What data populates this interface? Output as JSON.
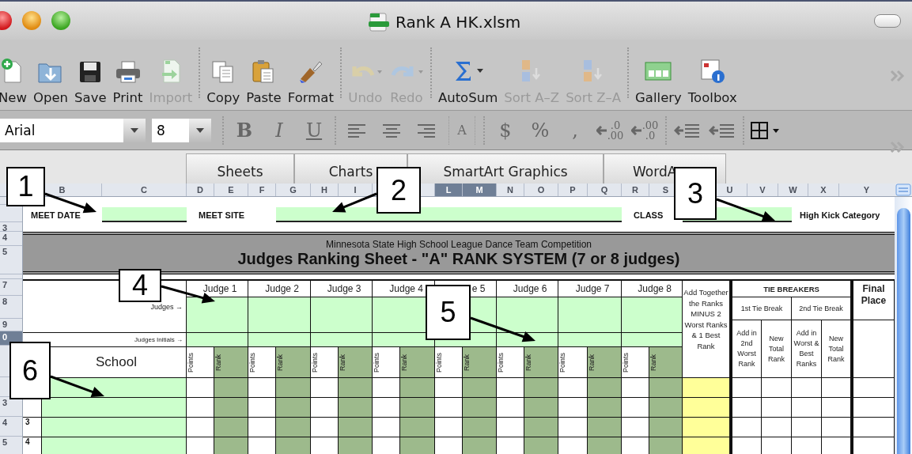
{
  "window": {
    "title": "Rank A HK.xlsm"
  },
  "toolbar": [
    {
      "kind": "new",
      "label": "New",
      "disabled": false
    },
    {
      "kind": "open",
      "label": "Open",
      "disabled": false
    },
    {
      "kind": "save",
      "label": "Save",
      "disabled": false
    },
    {
      "kind": "print",
      "label": "Print",
      "disabled": false
    },
    {
      "kind": "import",
      "label": "Import",
      "disabled": true
    },
    {
      "kind": "copy",
      "label": "Copy",
      "disabled": false
    },
    {
      "kind": "paste",
      "label": "Paste",
      "disabled": false
    },
    {
      "kind": "format",
      "label": "Format",
      "disabled": false
    },
    {
      "kind": "undo",
      "label": "Undo",
      "disabled": true
    },
    {
      "kind": "redo",
      "label": "Redo",
      "disabled": true
    },
    {
      "kind": "autosum",
      "label": "AutoSum",
      "disabled": false
    },
    {
      "kind": "sortaz",
      "label": "Sort A–Z",
      "disabled": true
    },
    {
      "kind": "sortza",
      "label": "Sort Z–A",
      "disabled": true
    },
    {
      "kind": "gallery",
      "label": "Gallery",
      "disabled": false
    },
    {
      "kind": "toolbox",
      "label": "Toolbox",
      "disabled": false
    }
  ],
  "format_bar": {
    "font": "Arial",
    "size": "8",
    "buttons": [
      {
        "kind": "bold",
        "label": "B",
        "disabled": true
      },
      {
        "kind": "italic",
        "label": "I",
        "disabled": true
      },
      {
        "kind": "underline",
        "label": "U",
        "disabled": true
      },
      {
        "kind": "align_left",
        "disabled": true
      },
      {
        "kind": "align_center",
        "disabled": true
      },
      {
        "kind": "align_right",
        "disabled": true
      },
      {
        "kind": "merge",
        "label": "A",
        "disabled": true
      },
      {
        "kind": "currency",
        "label": "$",
        "disabled": true
      },
      {
        "kind": "percent",
        "label": "%",
        "disabled": true
      },
      {
        "kind": "comma",
        "label": ",",
        "disabled": true
      },
      {
        "kind": "increase_decimal",
        "top": ".0",
        "bottom": ".00",
        "disabled": true
      },
      {
        "kind": "decrease_decimal",
        "top": ".00",
        "bottom": ".0",
        "disabled": true
      },
      {
        "kind": "outdent",
        "disabled": true
      },
      {
        "kind": "indent",
        "disabled": true
      },
      {
        "kind": "borders",
        "disabled": false
      }
    ]
  },
  "ribbon_tabs": [
    {
      "label": "Sheets"
    },
    {
      "label": "Charts"
    },
    {
      "label": "SmartArt Graphics"
    },
    {
      "label": "WordA"
    }
  ],
  "column_headers": [
    {
      "letter": "B",
      "selected": false
    },
    {
      "letter": "C",
      "selected": false
    },
    {
      "letter": "D",
      "selected": false
    },
    {
      "letter": "E",
      "selected": false
    },
    {
      "letter": "F",
      "selected": false
    },
    {
      "letter": "G",
      "selected": false
    },
    {
      "letter": "H",
      "selected": false
    },
    {
      "letter": "I",
      "selected": false
    },
    {
      "letter": "L",
      "selected": true
    },
    {
      "letter": "M",
      "selected": true
    },
    {
      "letter": "N",
      "selected": false
    },
    {
      "letter": "O",
      "selected": false
    },
    {
      "letter": "P",
      "selected": false
    },
    {
      "letter": "Q",
      "selected": false
    },
    {
      "letter": "R",
      "selected": false
    },
    {
      "letter": "S",
      "selected": false
    },
    {
      "letter": "U",
      "selected": false
    },
    {
      "letter": "V",
      "selected": false
    },
    {
      "letter": "W",
      "selected": false
    },
    {
      "letter": "X",
      "selected": false
    },
    {
      "letter": "Y",
      "selected": false
    }
  ],
  "row_headers": [
    {
      "selected": false
    },
    {
      "selected": false
    },
    {
      "label": "3",
      "selected": false
    },
    {
      "label": "4",
      "selected": false
    },
    {
      "label": "5",
      "selected": false
    },
    {
      "selected": false
    },
    {
      "label": "7",
      "selected": false
    },
    {
      "label": "8",
      "selected": false
    },
    {
      "label": "9",
      "selected": false
    },
    {
      "label": "0",
      "selected": true
    },
    {
      "selected": false
    },
    {
      "selected": false
    },
    {
      "label": "3",
      "selected": false
    },
    {
      "label": "4",
      "selected": false
    },
    {
      "label": "5",
      "selected": false
    }
  ],
  "meet_fields": [
    {
      "label": "MEET DATE"
    },
    {
      "label": "MEET SITE"
    },
    {
      "label": "CLASS"
    }
  ],
  "category_label": "High Kick Category",
  "banner": {
    "subtitle": "Minnesota State High School League Dance Team Competition",
    "title": "Judges Ranking Sheet - \"A\" RANK SYSTEM (7 or 8 judges)"
  },
  "table": {
    "judges_label": "Judges →",
    "initials_label": "Judges Initials →",
    "school_heading": "School",
    "judges": [
      {
        "name": "Judge 1",
        "points": "Points",
        "rank": "Rank"
      },
      {
        "name": "Judge 2",
        "points": "Points",
        "rank": "Rank"
      },
      {
        "name": "Judge 3",
        "points": "Points",
        "rank": "Rank"
      },
      {
        "name": "Judge 4",
        "points": "Points",
        "rank": "Rank"
      },
      {
        "name": "e 5",
        "points": "Points",
        "rank": "Rank"
      },
      {
        "name": "Judge 6",
        "points": "Points",
        "rank": "Rank"
      },
      {
        "name": "Judge 7",
        "points": "Points",
        "rank": "Rank"
      },
      {
        "name": "Judge 8",
        "points": "Points",
        "rank": "Rank"
      }
    ],
    "total_heading": "Add Together the Ranks MINUS 2 Worst Ranks & 1 Best Rank",
    "tie_heading": "TIE BREAKERS",
    "tie_groups": [
      {
        "label": "1st Tie Break"
      },
      {
        "label": "2nd Tie Break"
      }
    ],
    "tie_columns": [
      {
        "label": "Add in 2nd Worst Rank"
      },
      {
        "label": "New Total Rank"
      },
      {
        "label": "Add in Worst & Best Ranks"
      },
      {
        "label": "New Total Rank"
      }
    ],
    "final_heading": "Final Place",
    "rows": [
      {},
      {},
      {
        "number": "3"
      },
      {
        "number": "4"
      }
    ]
  },
  "callouts": [
    {
      "number": "1"
    },
    {
      "number": "2"
    },
    {
      "number": "3"
    },
    {
      "number": "4"
    },
    {
      "number": "5"
    },
    {
      "number": "6"
    }
  ]
}
